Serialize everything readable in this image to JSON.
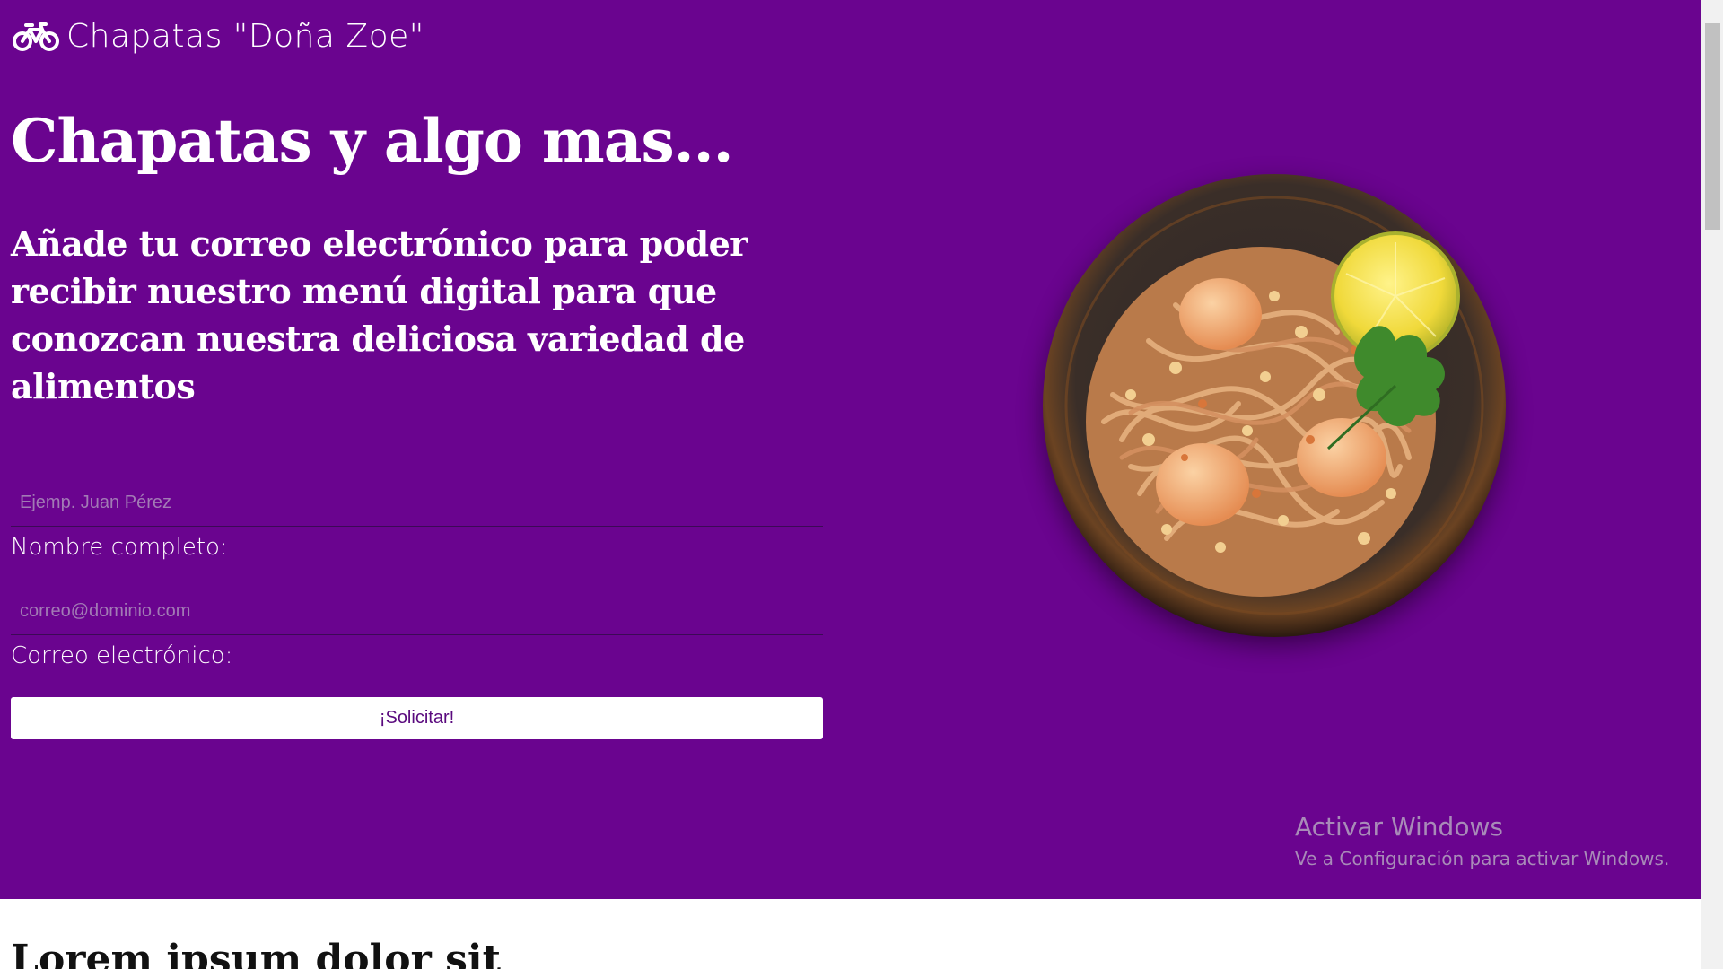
{
  "brand": {
    "icon": "bicycle-icon",
    "name": "Chapatas \"Doña Zoe\""
  },
  "hero": {
    "headline": "Chapatas y algo mas...",
    "subheadline": "Añade tu correo electrónico para poder recibir nuestro menú digital para que conozcan nuestra deliciosa variedad de alimentos",
    "background_color": "#6a048f",
    "image": "noodles-dish-image"
  },
  "form": {
    "name_field": {
      "placeholder": "Ejemp. Juan Pérez",
      "value": "",
      "label": "Nombre completo:"
    },
    "email_field": {
      "placeholder": "correo@dominio.com",
      "value": "",
      "label": "Correo electrónico:"
    },
    "submit_label": "¡Solicitar!"
  },
  "windows_watermark": {
    "title": "Activar Windows",
    "subtitle": "Ve a Configuración para activar Windows."
  },
  "next_section": {
    "heading": "Lorem ipsum dolor sit"
  }
}
